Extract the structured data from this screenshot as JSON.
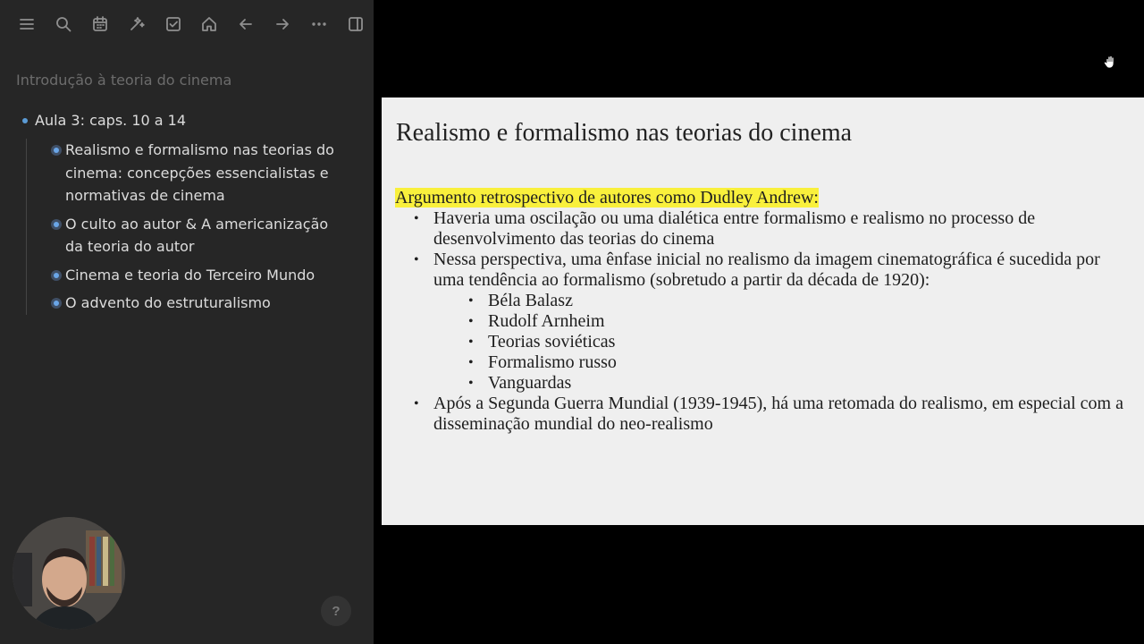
{
  "toolbar": {
    "icons": [
      "menu-icon",
      "search-icon",
      "calendar-icon",
      "magic-icon",
      "checkbox-icon",
      "home-icon",
      "back-arrow-icon",
      "forward-arrow-icon",
      "more-icon",
      "sidebar-toggle-icon"
    ]
  },
  "sidebar": {
    "doc_title": "Introdução à teoria do cinema",
    "root_item": "Aula 3: caps. 10 a 14",
    "children": [
      "Realismo e formalismo nas teorias do cinema: concepções essencialistas e normativas de cinema",
      "O culto ao autor & A americanização da teoria do autor",
      "Cinema e teoria do Terceiro Mundo",
      "O advento do estruturalismo"
    ],
    "help_label": "?"
  },
  "slide": {
    "title": "Realismo e formalismo nas teorias do cinema",
    "highlight_text": "Argumento retrospectivo de autores como Dudley Andrew:",
    "bullet_char": "•",
    "bullets": [
      "Haveria uma oscilação ou uma dialética entre formalismo e realismo no processo de desenvolvimento das teorias do cinema",
      "Nessa perspectiva, uma ênfase inicial no realismo da imagem cinematográfica é sucedida por uma tendência ao formalismo (sobretudo a partir da década de 1920):"
    ],
    "sub_bullets": [
      "Béla Balasz",
      "Rudolf Arnheim",
      "Teorias soviéticas",
      "Formalismo russo",
      "Vanguardas"
    ],
    "last_bullet": "Após a Segunda Guerra Mundial (1939-1945), há uma retomada do realismo, em especial com a disseminação mundial do neo-realismo"
  },
  "colors": {
    "sidebar_bg": "#262626",
    "accent_bullet": "#6aa6e8",
    "highlight": "#f9f03c",
    "slide_bg": "#efefef"
  }
}
